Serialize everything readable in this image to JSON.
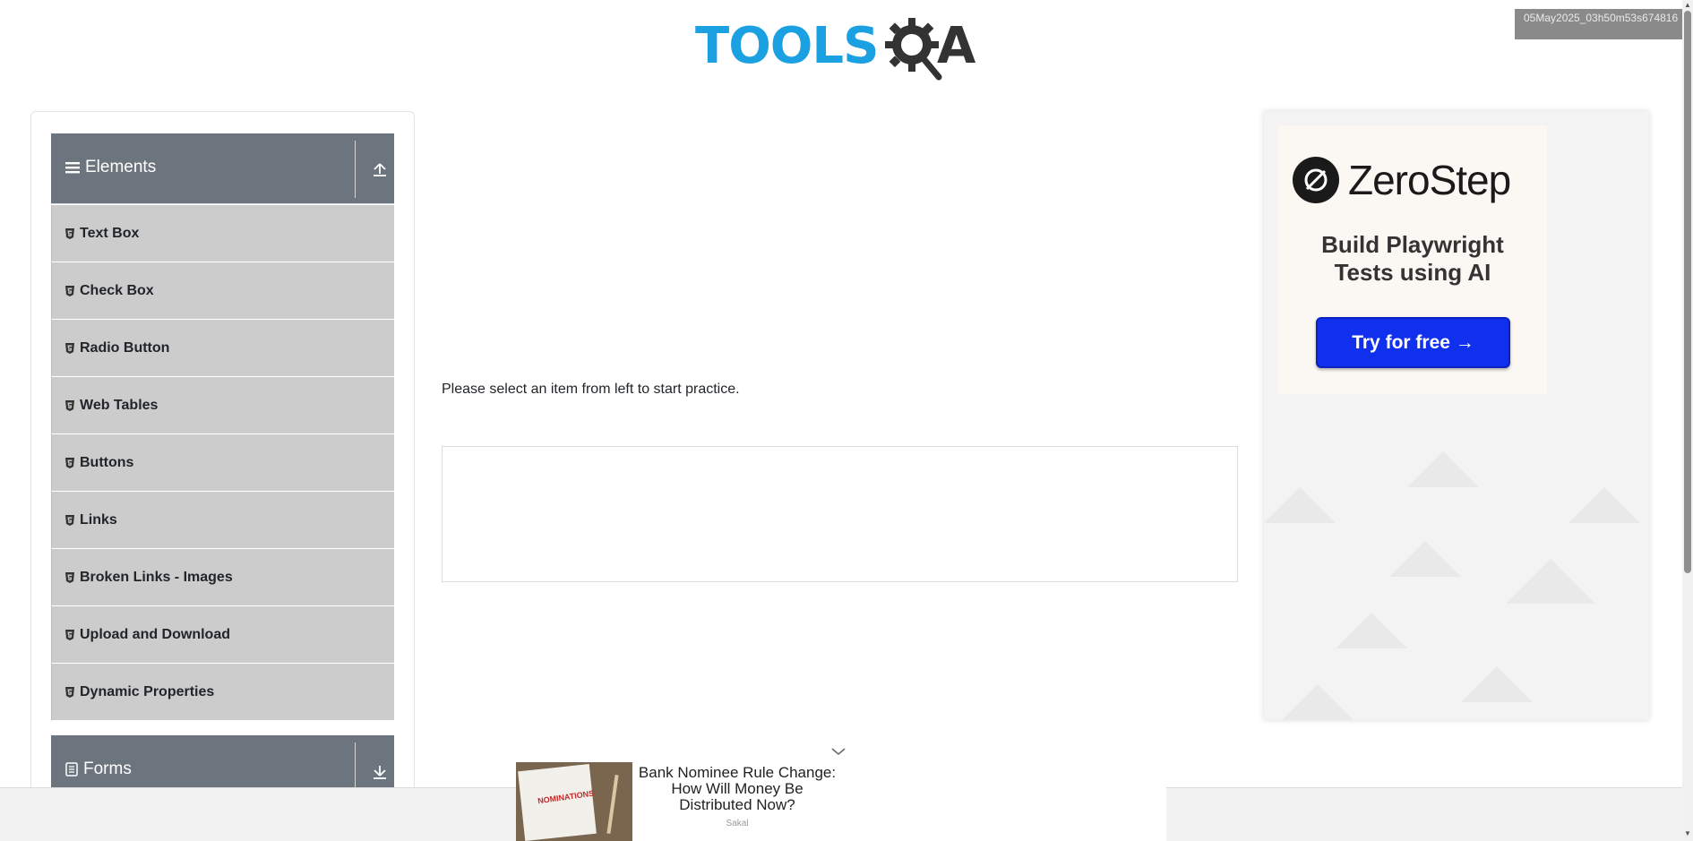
{
  "header": {
    "logo_text": "TOOLS",
    "logo_suffix": "A",
    "timestamp": "05May2025_03h50m53s674816"
  },
  "sidebar": {
    "elements_group": {
      "title": "Elements",
      "toggle_icon": "arrow-up-icon"
    },
    "items": [
      {
        "label": "Text Box"
      },
      {
        "label": "Check Box"
      },
      {
        "label": "Radio Button"
      },
      {
        "label": "Web Tables"
      },
      {
        "label": "Buttons"
      },
      {
        "label": "Links"
      },
      {
        "label": "Broken Links - Images"
      },
      {
        "label": "Upload and Download"
      },
      {
        "label": "Dynamic Properties"
      }
    ],
    "forms_group": {
      "title": "Forms",
      "toggle_icon": "arrow-down-icon"
    }
  },
  "main": {
    "instruction": "Please select an item from left to start practice."
  },
  "ad": {
    "brand": "ZeroStep",
    "tagline_line1": "Build Playwright",
    "tagline_line2": "Tests using AI",
    "cta": "Try for free →"
  },
  "bottom_ad": {
    "headline": "Bank Nominee Rule Change: How Will Money Be Distributed Now?",
    "source": "Sakal",
    "thumb_caption": "NOMINATIONS"
  },
  "colors": {
    "logo_blue": "#1ba1e2",
    "group_header_bg": "#6c757d",
    "menu_item_bg": "#cccccc",
    "cta_blue": "#1030ee"
  }
}
